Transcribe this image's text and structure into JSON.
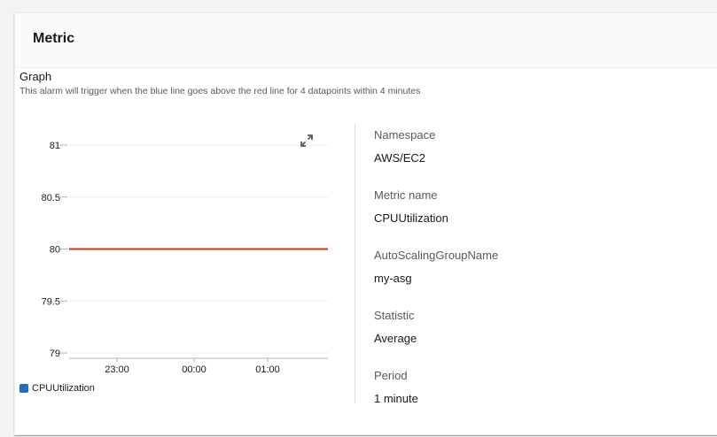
{
  "panel": {
    "title": "Metric"
  },
  "graph": {
    "title": "Graph",
    "description": "This alarm will trigger when the blue line goes above the red line for 4 datapoints within 4 minutes",
    "expand_icon": "expand-icon"
  },
  "chart_data": {
    "type": "line",
    "y_ticks": [
      "81",
      "80.5",
      "80",
      "79.5",
      "79"
    ],
    "ylim": [
      79,
      81
    ],
    "x_ticks": [
      "23:00",
      "00:00",
      "01:00"
    ],
    "series": [
      {
        "name": "CPUUtilization",
        "color": "#1f6ec2",
        "values": []
      }
    ],
    "threshold": {
      "value": 80,
      "color": "#d13212"
    },
    "grid": true,
    "legend_placement": "bottom-left"
  },
  "details": [
    {
      "label": "Namespace",
      "value": "AWS/EC2"
    },
    {
      "label": "Metric name",
      "value": "CPUUtilization"
    },
    {
      "label": "AutoScalingGroupName",
      "value": "my-asg"
    },
    {
      "label": "Statistic",
      "value": "Average"
    },
    {
      "label": "Period",
      "value": "1 minute"
    }
  ],
  "colors": {
    "header_bg": "#fafafa",
    "text": "#16191f",
    "secondary_text": "#545b64",
    "threshold": "#d13212",
    "series": "#1f6ec2"
  }
}
